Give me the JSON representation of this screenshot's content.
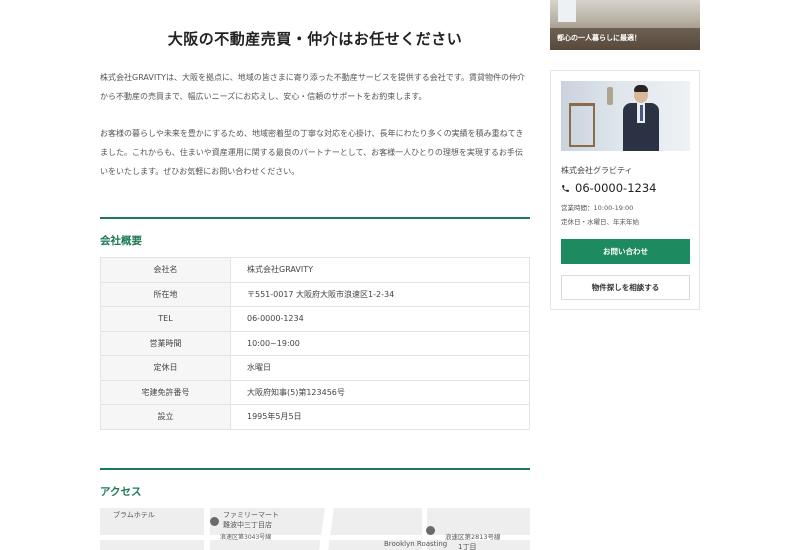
{
  "main": {
    "title": "大阪の不動産売買・仲介はお任せください",
    "intro": [
      "株式会社GRAVITYは、大阪を拠点に、地域の皆さまに寄り添った不動産サービスを提供する会社です。賃貸物件の仲介から不動産の売買まで、幅広いニーズにお応えし、安心・信頼のサポートをお約束します。",
      "お客様の暮らしや未来を豊かにするため、地域密着型の丁寧な対応を心掛け、長年にわたり多くの実績を積み重ねてきました。これからも、住まいや資産運用に関する最良のパートナーとして、お客様一人ひとりの理想を実現するお手伝いをいたします。ぜひお気軽にお問い合わせください。"
    ],
    "overview": {
      "heading": "会社概要",
      "rows": [
        {
          "key": "会社名",
          "value": "株式会社GRAVITY"
        },
        {
          "key": "所在地",
          "value": "〒551-0017 大阪府大阪市浪速区1-2-34"
        },
        {
          "key": "TEL",
          "value": "06-0000-1234"
        },
        {
          "key": "営業時間",
          "value": "10:00~19:00"
        },
        {
          "key": "定休日",
          "value": "水曜日"
        },
        {
          "key": "宅建免許番号",
          "value": "大阪府知事(5)第123456号"
        },
        {
          "key": "設立",
          "value": "1995年5月5日"
        }
      ]
    },
    "access": {
      "heading": "アクセス",
      "map_labels": {
        "hotel": "ブラムホテル",
        "familymart": "ファミリーマート",
        "familymart_sub": "難波中三丁目店",
        "street_a": "浪速区第3043号線",
        "street_b": "浪速区第2813号線",
        "cafe": "Brooklyn Roasting",
        "chome": "1丁目"
      }
    }
  },
  "sidebar": {
    "banner_caption": "都心の一人暮らしに最適！",
    "company_name": "株式会社グラビティ",
    "phone": "06-0000-1234",
    "hours": "営業時間：10:00-19:00",
    "holiday": "定休日・水曜日、年末年始",
    "contact_button": "お問い合わせ",
    "consult_button": "物件探しを相談する"
  },
  "colors": {
    "accent": "#1e7a55",
    "button": "#1e8a5f"
  }
}
